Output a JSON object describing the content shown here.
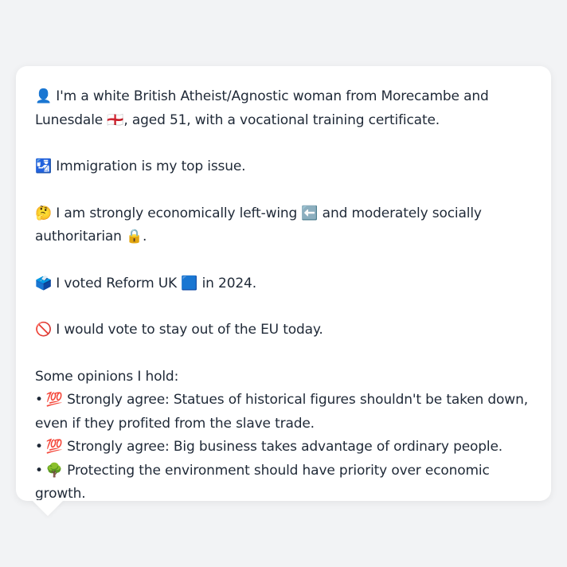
{
  "profile": {
    "identity": "👤 I'm a white British Atheist/Agnostic woman from Morecambe and Lunesdale 🏴󠁧󠁢󠁥󠁮󠁧󠁿, aged 51, with a vocational training certificate.",
    "top_issue": "🛂 Immigration is my top issue.",
    "ideology": "🤔 I am strongly economically left-wing ⬅️ and moderately socially authoritarian 🔒.",
    "vote": "🗳️ I voted Reform UK 🟦 in 2024.",
    "eu": "🚫 I would vote to stay out of the EU today."
  },
  "opinions": {
    "heading": "Some opinions I hold:",
    "bullet": "•",
    "items": [
      "💯 Strongly agree: Statues of historical figures shouldn't be taken down, even if they profited from the slave trade.",
      "💯 Strongly agree: Big business takes advantage of ordinary people.",
      "🌳 Protecting the environment should have priority over economic growth."
    ]
  }
}
